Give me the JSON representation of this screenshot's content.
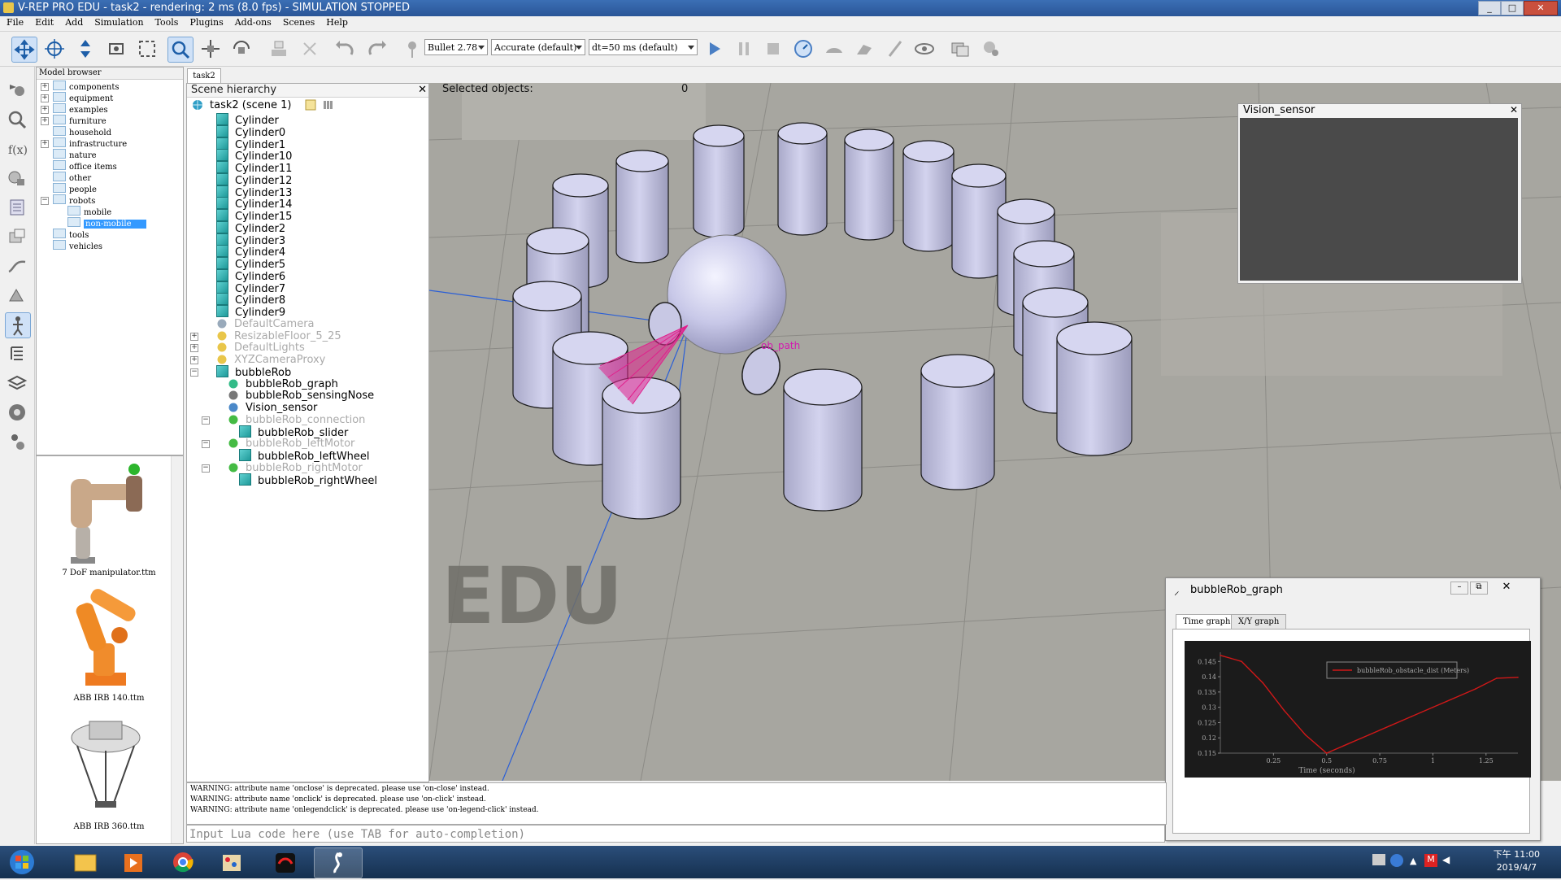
{
  "window": {
    "title": "V-REP PRO EDU - task2 - rendering: 2 ms (8.0 fps) - SIMULATION STOPPED"
  },
  "menu": [
    "File",
    "Edit",
    "Add",
    "Simulation",
    "Tools",
    "Plugins",
    "Add-ons",
    "Scenes",
    "Help"
  ],
  "toolbar": {
    "engine": "Bullet 2.78",
    "accuracy": "Accurate (default)",
    "timestep": "dt=50 ms (default)"
  },
  "model_browser": {
    "title": "Model browser",
    "folders": [
      {
        "label": "components",
        "expandable": true
      },
      {
        "label": "equipment",
        "expandable": true
      },
      {
        "label": "examples",
        "expandable": true
      },
      {
        "label": "furniture",
        "expandable": true
      },
      {
        "label": "household",
        "expandable": false
      },
      {
        "label": "infrastructure",
        "expandable": true
      },
      {
        "label": "nature",
        "expandable": false
      },
      {
        "label": "office items",
        "expandable": false
      },
      {
        "label": "other",
        "expandable": false
      },
      {
        "label": "people",
        "expandable": false
      },
      {
        "label": "robots",
        "expandable": true
      },
      {
        "label": "mobile",
        "expandable": false
      },
      {
        "label": "non-mobile",
        "expandable": false,
        "selected": true
      },
      {
        "label": "tools",
        "expandable": false
      },
      {
        "label": "vehicles",
        "expandable": false
      }
    ],
    "thumbnails": [
      "7 DoF manipulator.ttm",
      "ABB IRB 140.ttm",
      "ABB IRB 360.ttm"
    ]
  },
  "scene_tab": "task2",
  "hierarchy": {
    "title": "Scene hierarchy",
    "root": "task2 (scene 1)",
    "items": [
      {
        "label": "Cylinder"
      },
      {
        "label": "Cylinder0"
      },
      {
        "label": "Cylinder1"
      },
      {
        "label": "Cylinder10"
      },
      {
        "label": "Cylinder11"
      },
      {
        "label": "Cylinder12"
      },
      {
        "label": "Cylinder13"
      },
      {
        "label": "Cylinder14"
      },
      {
        "label": "Cylinder15"
      },
      {
        "label": "Cylinder2"
      },
      {
        "label": "Cylinder3"
      },
      {
        "label": "Cylinder4"
      },
      {
        "label": "Cylinder5"
      },
      {
        "label": "Cylinder6"
      },
      {
        "label": "Cylinder7"
      },
      {
        "label": "Cylinder8"
      },
      {
        "label": "Cylinder9"
      },
      {
        "label": "DefaultCamera"
      },
      {
        "label": "ResizableFloor_5_25"
      },
      {
        "label": "DefaultLights"
      },
      {
        "label": "XYZCameraProxy"
      },
      {
        "label": "bubbleRob"
      },
      {
        "label": "bubbleRob_graph"
      },
      {
        "label": "bubbleRob_sensingNose"
      },
      {
        "label": "Vision_sensor"
      },
      {
        "label": "bubbleRob_connection"
      },
      {
        "label": "bubbleRob_slider"
      },
      {
        "label": "bubbleRob_leftMotor"
      },
      {
        "label": "bubbleRob_leftWheel"
      },
      {
        "label": "bubbleRob_rightMotor"
      },
      {
        "label": "bubbleRob_rightWheel"
      }
    ]
  },
  "viewport": {
    "selected_label": "Selected objects:",
    "selected_count": "0",
    "path_label": "ob_path",
    "watermark": "EDU"
  },
  "vision_window": {
    "title": "Vision_sensor"
  },
  "graph_window": {
    "title": "bubbleRob_graph",
    "tabs": [
      "Time graph",
      "X/Y graph"
    ],
    "line_color": "#d01818"
  },
  "chart_data": {
    "type": "line",
    "xlabel": "Time (seconds)",
    "ylabel": "",
    "xlim": [
      0,
      1.4
    ],
    "ylim": [
      0.115,
      0.148
    ],
    "xticks": [
      "0.25",
      "0.5",
      "0.75",
      "1",
      "1.25"
    ],
    "yticks": [
      "0.145",
      "0.14",
      "0.135",
      "0.13",
      "0.125",
      "0.12",
      "0.115"
    ],
    "series": [
      {
        "name": "bubbleRob_obstacle_dist (Meters)",
        "x": [
          0,
          0.05,
          0.1,
          0.2,
          0.3,
          0.4,
          0.5,
          0.6,
          0.7,
          0.8,
          0.9,
          1.0,
          1.1,
          1.2,
          1.3,
          1.4
        ],
        "y": [
          0.147,
          0.146,
          0.145,
          0.138,
          0.129,
          0.121,
          0.115,
          0.118,
          0.121,
          0.124,
          0.127,
          0.13,
          0.133,
          0.136,
          0.1395,
          0.1398
        ]
      }
    ],
    "legend": "top-right",
    "grid": false
  },
  "console": {
    "lines": [
      "WARNING: attribute name 'onclose' is deprecated. please use 'on-close' instead.",
      "WARNING: attribute name 'onclick' is deprecated. please use 'on-click' instead.",
      "WARNING: attribute name 'onlegendclick' is deprecated. please use 'on-legend-click' instead."
    ]
  },
  "lua_input": {
    "placeholder": "Input Lua code here (use TAB for auto-completion)"
  },
  "taskbar": {
    "time": "下午 11:00",
    "date": "2019/4/7"
  }
}
